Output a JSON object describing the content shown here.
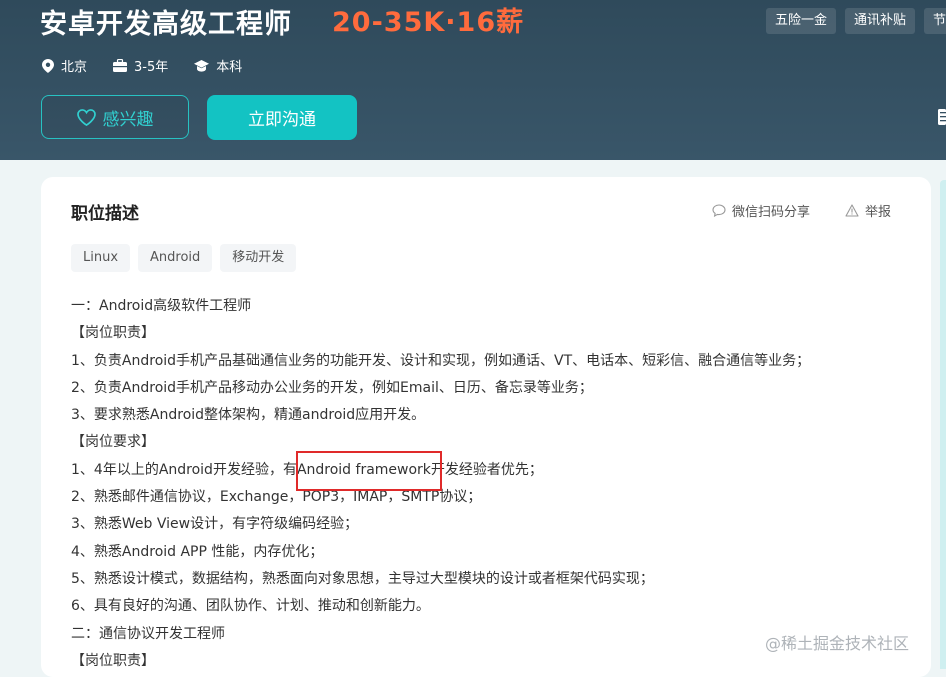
{
  "job": {
    "title": "安卓开发高级工程师",
    "salary": "20-35K·16薪",
    "location": "北京",
    "experience": "3-5年",
    "education": "本科"
  },
  "buttons": {
    "interest_label": "感兴趣",
    "chat_label": "立即沟通"
  },
  "benefits": [
    "五险一金",
    "通讯补贴",
    "节"
  ],
  "colors": {
    "header_bg": "#344f61",
    "accent": "#13c3c3",
    "salary": "#ff6b3d",
    "highlight": "#e02a2a"
  },
  "description": {
    "title": "职位描述",
    "share_label": "微信扫码分享",
    "report_label": "举报",
    "tags": [
      "Linux",
      "Android",
      "移动开发"
    ],
    "lines": [
      "一：Android高级软件工程师",
      "【岗位职责】",
      "1、负责Android手机产品基础通信业务的功能开发、设计和实现，例如通话、VT、电话本、短彩信、融合通信等业务；",
      "2、负责Android手机产品移动办公业务的开发，例如Email、日历、备忘录等业务；",
      "3、要求熟悉Android整体架构，精通android应用开发。",
      "【岗位要求】",
      "1、4年以上的Android开发经验，有Android framework开发经验者优先；",
      "2、熟悉邮件通信协议，Exchange，POP3，IMAP，SMTP协议；",
      "3、熟悉Web View设计，有字符级编码经验；",
      "4、熟悉Android APP 性能，内存优化；",
      "5、熟悉设计模式，数据结构，熟悉面向对象思想，主导过大型模块的设计或者框架代码实现；",
      "6、具有良好的沟通、团队协作、计划、推动和创新能力。",
      "二：通信协议开发工程师",
      "【岗位职责】"
    ]
  },
  "watermark": "@稀土掘金技术社区"
}
